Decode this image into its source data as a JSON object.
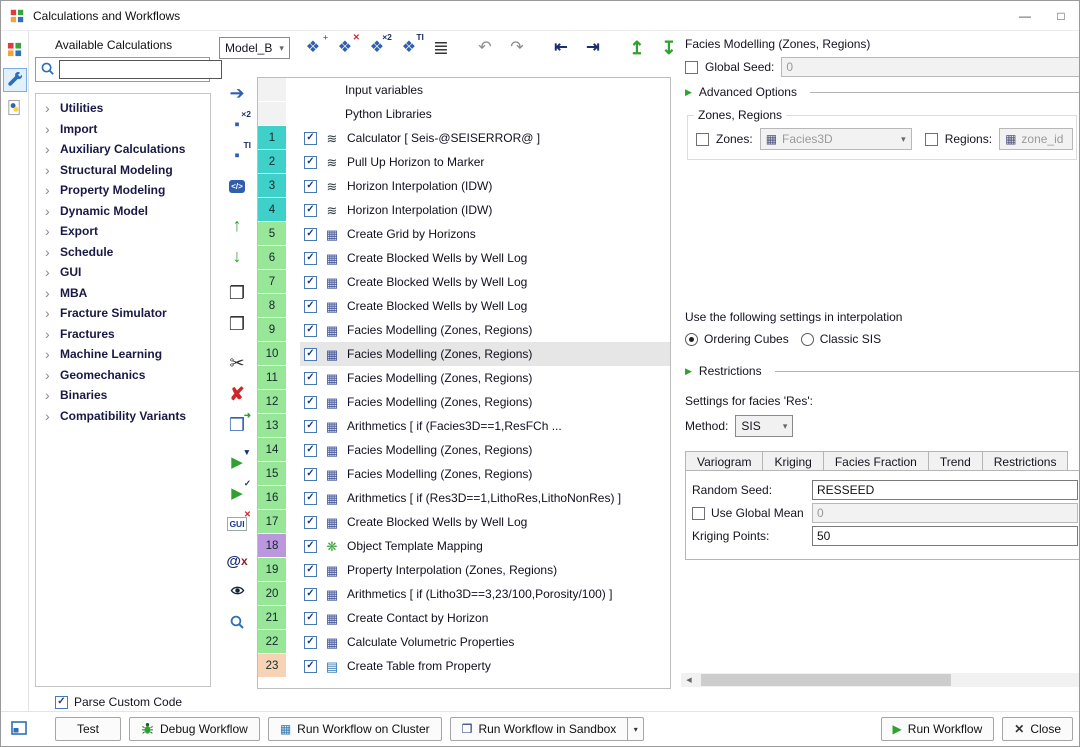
{
  "titlebar": {
    "title": "Calculations and Workflows"
  },
  "window_controls": {
    "minimize": "—",
    "maximize": "□"
  },
  "left_panel": {
    "title": "Available Calculations",
    "search_value": "",
    "tree": [
      {
        "label": "Utilities"
      },
      {
        "label": "Import"
      },
      {
        "label": "Auxiliary Calculations"
      },
      {
        "label": "Structural Modeling"
      },
      {
        "label": "Property Modeling"
      },
      {
        "label": "Dynamic Model"
      },
      {
        "label": "Export"
      },
      {
        "label": "Schedule"
      },
      {
        "label": "GUI"
      },
      {
        "label": "MBA"
      },
      {
        "label": "Fracture Simulator"
      },
      {
        "label": "Fractures"
      },
      {
        "label": "Machine Learning"
      },
      {
        "label": "Geomechanics"
      },
      {
        "label": "Binaries"
      },
      {
        "label": "Compatibility Variants"
      }
    ],
    "parse_custom_code": "Parse Custom Code"
  },
  "toolbar": {
    "model_selector": "Model_B"
  },
  "workflow": {
    "headers": [
      {
        "label": "Input variables"
      },
      {
        "label": "Python Libraries"
      }
    ],
    "steps": [
      {
        "num": "1",
        "label": "Calculator [ Seis-@SEISERROR@ ]",
        "icon": "seismic-waves-icon",
        "glyph": "≋",
        "glyph_color": "#2e3b40",
        "num_bg": "#3fd0c9"
      },
      {
        "num": "2",
        "label": "Pull Up Horizon to Marker",
        "icon": "seismic-waves-icon",
        "glyph": "≋",
        "glyph_color": "#2e3b40",
        "num_bg": "#3fd0c9"
      },
      {
        "num": "3",
        "label": "Horizon Interpolation (IDW)",
        "icon": "seismic-waves-icon",
        "glyph": "≋",
        "glyph_color": "#2e3b40",
        "num_bg": "#3fd0c9"
      },
      {
        "num": "4",
        "label": "Horizon Interpolation (IDW)",
        "icon": "seismic-waves-icon",
        "glyph": "≋",
        "glyph_color": "#2e3b40",
        "num_bg": "#3fd0c9"
      },
      {
        "num": "5",
        "label": "Create Grid by Horizons",
        "icon": "grid-cube-icon",
        "glyph": "▦",
        "glyph_color": "#3b4f93",
        "num_bg": "#98e698"
      },
      {
        "num": "6",
        "label": "Create Blocked Wells by Well Log",
        "icon": "grid-cube-icon",
        "glyph": "▦",
        "glyph_color": "#3b4f93",
        "num_bg": "#98e698"
      },
      {
        "num": "7",
        "label": "Create Blocked Wells by Well Log",
        "icon": "grid-cube-icon",
        "glyph": "▦",
        "glyph_color": "#3b4f93",
        "num_bg": "#98e698"
      },
      {
        "num": "8",
        "label": "Create Blocked Wells by Well Log",
        "icon": "grid-cube-icon",
        "glyph": "▦",
        "glyph_color": "#3b4f93",
        "num_bg": "#98e698"
      },
      {
        "num": "9",
        "label": "Facies Modelling (Zones, Regions)",
        "icon": "grid-cube-icon",
        "glyph": "▦",
        "glyph_color": "#3b4f93",
        "num_bg": "#98e698"
      },
      {
        "num": "10",
        "label": "Facies Modelling (Zones, Regions)",
        "icon": "grid-cube-icon",
        "glyph": "▦",
        "glyph_color": "#3b4f93",
        "num_bg": "#98e698",
        "selected": true
      },
      {
        "num": "11",
        "label": "Facies Modelling (Zones, Regions)",
        "icon": "grid-cube-icon",
        "glyph": "▦",
        "glyph_color": "#3b4f93",
        "num_bg": "#98e698"
      },
      {
        "num": "12",
        "label": "Facies Modelling (Zones, Regions)",
        "icon": "grid-cube-icon",
        "glyph": "▦",
        "glyph_color": "#3b4f93",
        "num_bg": "#98e698"
      },
      {
        "num": "13",
        "label": "Arithmetics [ if (Facies3D==1,ResFCh ...",
        "icon": "grid-cube-icon",
        "glyph": "▦",
        "glyph_color": "#3b4f93",
        "num_bg": "#98e698"
      },
      {
        "num": "14",
        "label": "Facies Modelling (Zones, Regions)",
        "icon": "grid-cube-icon",
        "glyph": "▦",
        "glyph_color": "#3b4f93",
        "num_bg": "#98e698"
      },
      {
        "num": "15",
        "label": "Facies Modelling (Zones, Regions)",
        "icon": "grid-cube-icon",
        "glyph": "▦",
        "glyph_color": "#3b4f93",
        "num_bg": "#98e698"
      },
      {
        "num": "16",
        "label": "Arithmetics [ if (Res3D==1,LithoRes,LithoNonRes) ]",
        "icon": "grid-cube-icon",
        "glyph": "▦",
        "glyph_color": "#3b4f93",
        "num_bg": "#98e698"
      },
      {
        "num": "17",
        "label": "Create Blocked Wells by Well Log",
        "icon": "grid-cube-icon",
        "glyph": "▦",
        "glyph_color": "#3b4f93",
        "num_bg": "#98e698"
      },
      {
        "num": "18",
        "label": "Object Template Mapping",
        "icon": "template-gear-icon",
        "glyph": "❋",
        "glyph_color": "#3aa03a",
        "num_bg": "#bb97de"
      },
      {
        "num": "19",
        "label": "Property Interpolation (Zones, Regions)",
        "icon": "grid-cube-icon",
        "glyph": "▦",
        "glyph_color": "#3b4f93",
        "num_bg": "#98e698"
      },
      {
        "num": "20",
        "label": "Arithmetics [ if (Litho3D==3,23/100,Porosity/100) ]",
        "icon": "grid-cube-icon",
        "glyph": "▦",
        "glyph_color": "#3b4f93",
        "num_bg": "#98e698"
      },
      {
        "num": "21",
        "label": "Create Contact by Horizon",
        "icon": "grid-cube-icon",
        "glyph": "▦",
        "glyph_color": "#3b4f93",
        "num_bg": "#98e698"
      },
      {
        "num": "22",
        "label": "Calculate Volumetric Properties",
        "icon": "grid-cube-icon",
        "glyph": "▦",
        "glyph_color": "#3b4f93",
        "num_bg": "#98e698"
      },
      {
        "num": "23",
        "label": "Create Table from Property",
        "icon": "table-icon",
        "glyph": "▤",
        "glyph_color": "#2e74b5",
        "num_bg": "#f7d3b5"
      }
    ]
  },
  "properties": {
    "title": "Facies Modelling (Zones, Regions)",
    "global_seed": {
      "label": "Global Seed:",
      "value": "0"
    },
    "advanced_options_label": "Advanced Options",
    "zones_regions": {
      "caption": "Zones, Regions",
      "zones_label": "Zones:",
      "zones_value": "Facies3D",
      "regions_label": "Regions:",
      "regions_value": "zone_id"
    },
    "interpolation": {
      "caption": "Use the following settings in interpolation",
      "options": [
        {
          "label": "Ordering Cubes",
          "selected": true
        },
        {
          "label": "Classic SIS"
        }
      ]
    },
    "restrictions_label": "Restrictions",
    "facies_settings": {
      "caption": "Settings for facies 'Res':",
      "method_label": "Method:",
      "method_value": "SIS"
    },
    "tabs": [
      {
        "label": "Variogram"
      },
      {
        "label": "Kriging",
        "active": true
      },
      {
        "label": "Facies Fraction"
      },
      {
        "label": "Trend"
      },
      {
        "label": "Restrictions"
      }
    ],
    "kriging": {
      "random_seed_label": "Random Seed:",
      "random_seed_value": "RESSEED",
      "use_global_mean_label": "Use Global Mean",
      "use_global_mean_value": "0",
      "kriging_points_label": "Kriging Points:",
      "kriging_points_value": "50"
    }
  },
  "bottom_bar": {
    "test": "Test",
    "debug": "Debug Workflow",
    "run_cluster": "Run Workflow on Cluster",
    "run_sandbox": "Run Workflow in Sandbox",
    "run": "Run Workflow",
    "close": "Close"
  },
  "icons": {
    "chevron_right": "›",
    "check": "✓",
    "combo_arrow": "▾",
    "expander": "▶",
    "step_base": "❖",
    "add_badge": "+",
    "delete_badge": "✕",
    "x2_badge": "×2",
    "ti_badge": "TI",
    "book": "≣",
    "undo": "↶",
    "redo": "↷",
    "first": "⇤",
    "last": "⇥",
    "upload": "↥",
    "download": "↧",
    "export_row": "➔",
    "square": "▪",
    "x2_chip": "×2",
    "ti_chip": "TI",
    "code_chip": "</>",
    "up": "↑",
    "down": "↓",
    "copy": "❐",
    "paste": "❒",
    "cut": "✂",
    "delete": "✘",
    "paste_badge": "➜",
    "play": "▶",
    "funnel_badge": "▼",
    "gui_chip": "GUI",
    "at": "@",
    "x": "x",
    "cube": "▦",
    "sandbox": "❒",
    "scroll_left": "◀",
    "close": "✕"
  }
}
